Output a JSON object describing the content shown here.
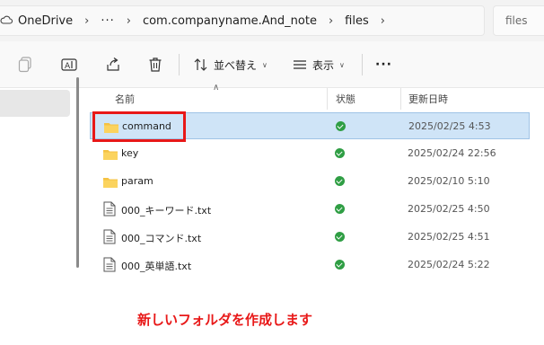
{
  "address_bar": {
    "breadcrumbs": [
      "OneDrive",
      "···",
      "com.companyname.And_note",
      "files"
    ],
    "search_placeholder": "files"
  },
  "toolbar": {
    "sort_label": "並べ替え",
    "view_label": "表示",
    "more_label": "···"
  },
  "columns": {
    "name": "名前",
    "status": "状態",
    "modified": "更新日時"
  },
  "files": [
    {
      "name": "command",
      "kind": "folder",
      "status_icon": "synced-check-icon",
      "modified": "2025/02/25 4:53",
      "selected": true
    },
    {
      "name": "key",
      "kind": "folder",
      "status_icon": "synced-check-icon",
      "modified": "2025/02/24 22:56",
      "selected": false
    },
    {
      "name": "param",
      "kind": "folder",
      "status_icon": "synced-check-icon",
      "modified": "2025/02/10 5:10",
      "selected": false
    },
    {
      "name": "000_キーワード.txt",
      "kind": "text-file",
      "status_icon": "synced-check-icon",
      "modified": "2025/02/25 4:50",
      "selected": false
    },
    {
      "name": "000_コマンド.txt",
      "kind": "text-file",
      "status_icon": "synced-check-icon",
      "modified": "2025/02/25 4:51",
      "selected": false
    },
    {
      "name": "000_英単語.txt",
      "kind": "text-file",
      "status_icon": "synced-check-icon",
      "modified": "2025/02/24 5:22",
      "selected": false
    }
  ],
  "annotation": {
    "caption": "新しいフォルダを作成します",
    "color": "#e81818"
  },
  "colors": {
    "selection_bg": "#cfe4f7",
    "folder_yellow": "#f5c242",
    "status_green": "#2f9e44"
  }
}
